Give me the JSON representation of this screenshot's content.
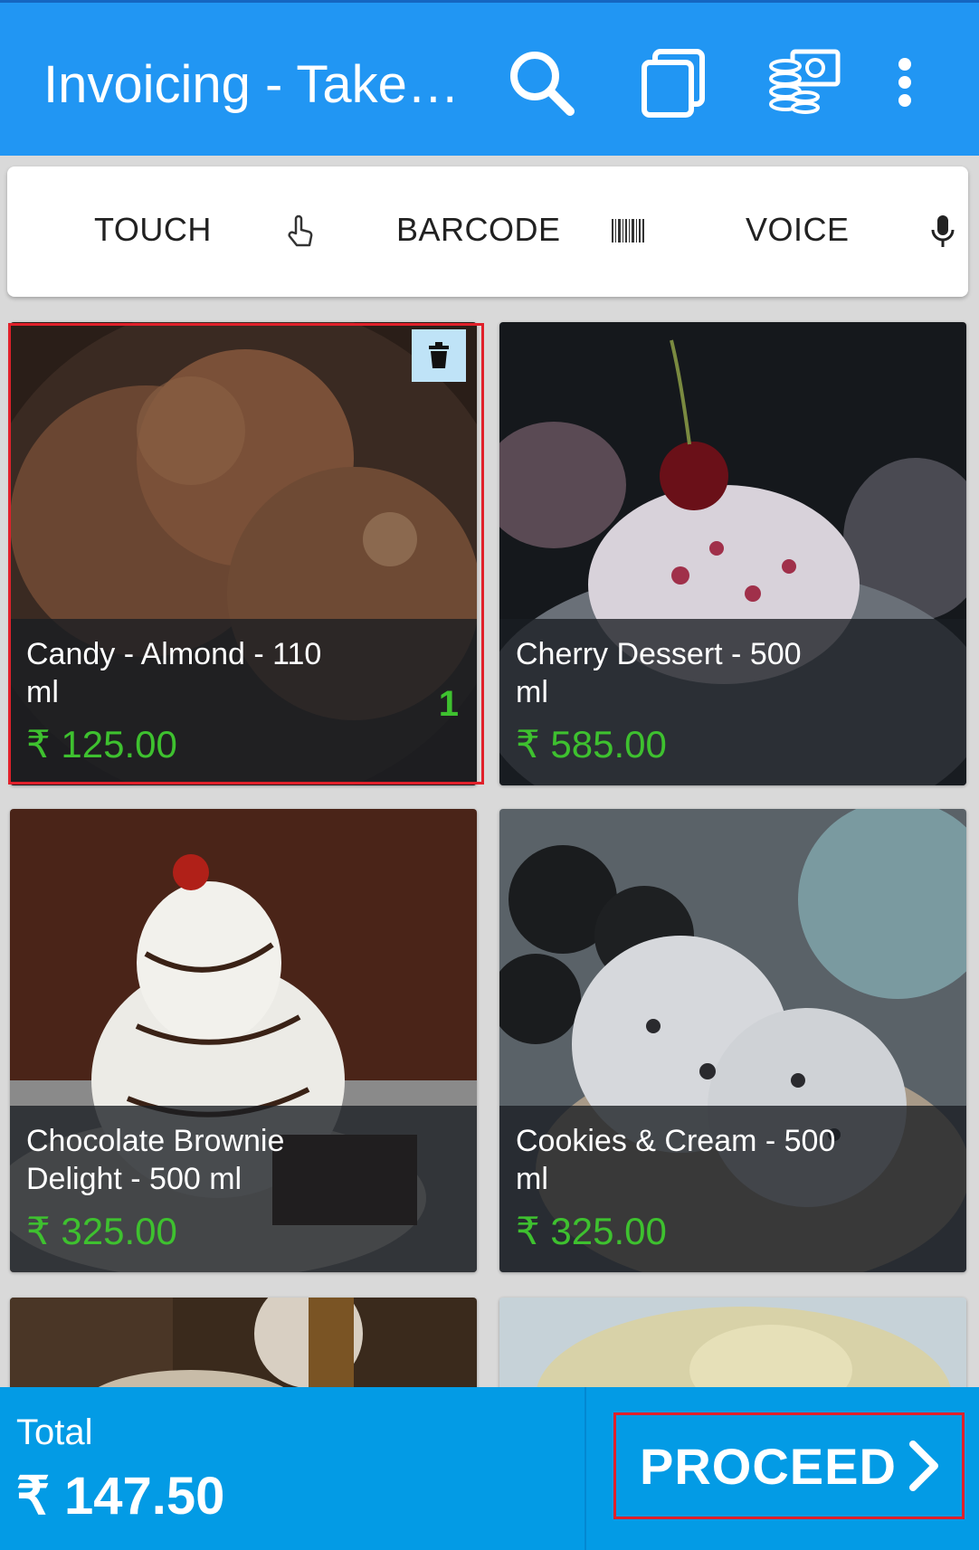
{
  "appbar": {
    "title": "Invoicing - Take Away",
    "actions": [
      "search-icon",
      "copy-icon",
      "cash-icon",
      "more-vert-icon"
    ]
  },
  "input_modes": [
    {
      "label": "TOUCH",
      "icon": "touch-icon"
    },
    {
      "label": "BARCODE",
      "icon": "barcode-icon"
    },
    {
      "label": "VOICE",
      "icon": "mic-icon"
    }
  ],
  "products": [
    {
      "name": "Candy - Almond - 110 ml",
      "price": "₹ 125.00",
      "qty": "1",
      "selected": true
    },
    {
      "name": "Cherry Dessert - 500 ml",
      "price": "₹ 585.00"
    },
    {
      "name": "Chocolate Brownie Delight - 500 ml",
      "price": "₹ 325.00"
    },
    {
      "name": "Cookies & Cream - 500 ml",
      "price": "₹ 325.00"
    }
  ],
  "footer": {
    "total_label": "Total",
    "total_value": "₹ 147.50",
    "proceed_label": "PROCEED"
  },
  "colors": {
    "appbar": "#2196f3",
    "footer": "#039be5",
    "price": "#3ec12f",
    "highlight": "#e0202a"
  }
}
